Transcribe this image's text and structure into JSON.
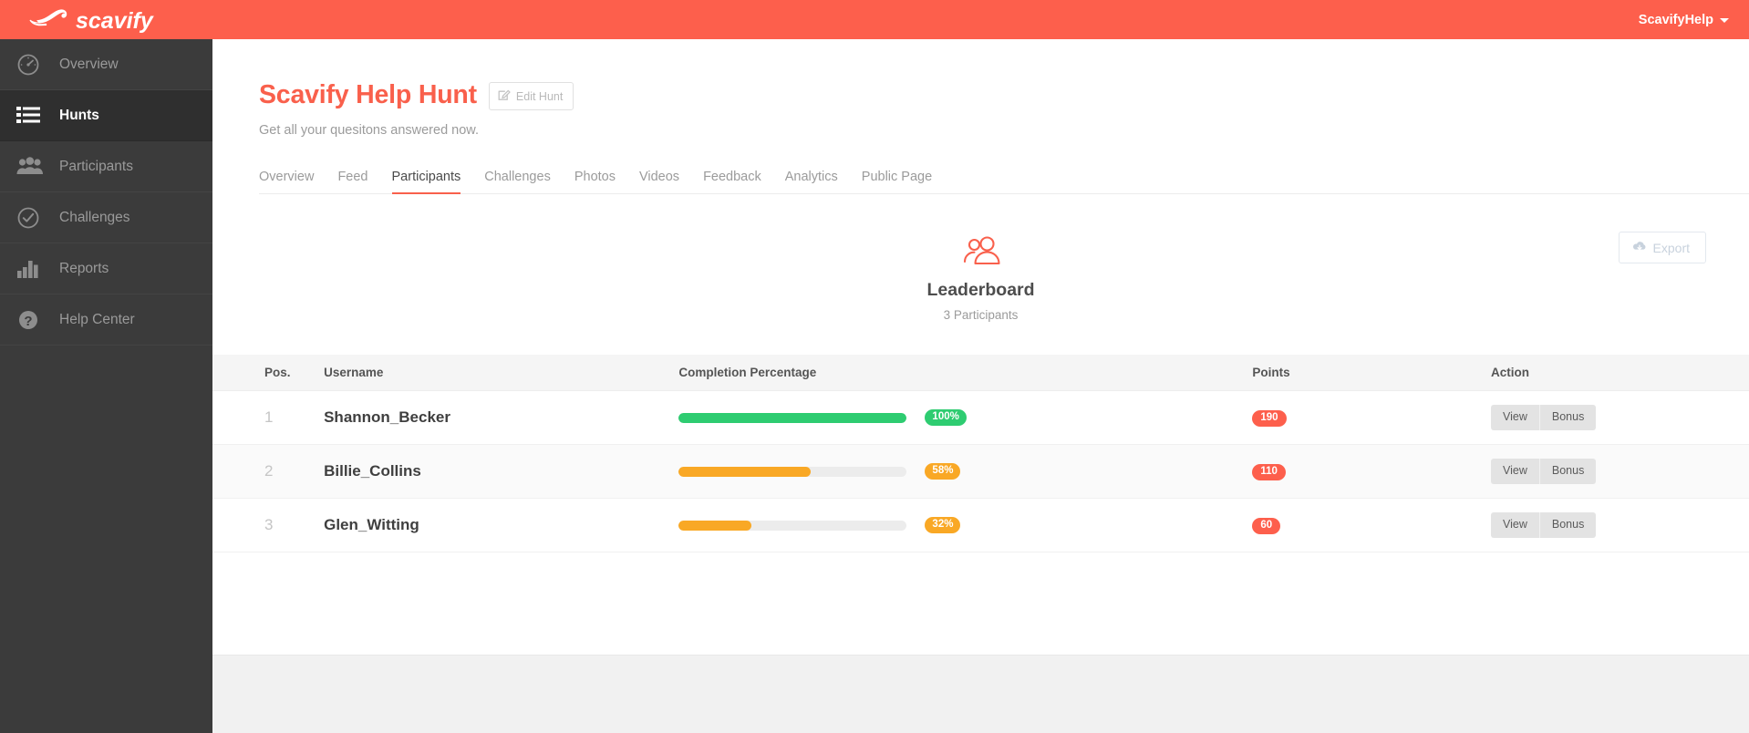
{
  "topbar": {
    "brand_name": "scavify",
    "brand_icon": "scavify-cheetah-logo",
    "user_menu_label": "ScavifyHelp",
    "caret_icon": "chevron-down-icon",
    "background_color": "#fd5f4c"
  },
  "sidebar": {
    "background_color": "#3b3b3b",
    "items": [
      {
        "label": "Overview",
        "icon": "gauge-icon",
        "active": false
      },
      {
        "label": "Hunts",
        "icon": "list-icon",
        "active": true
      },
      {
        "label": "Participants",
        "icon": "people-icon",
        "active": false
      },
      {
        "label": "Challenges",
        "icon": "check-circle-icon",
        "active": false
      },
      {
        "label": "Reports",
        "icon": "bar-chart-icon",
        "active": false
      },
      {
        "label": "Help Center",
        "icon": "question-mark-circle-icon",
        "active": false
      }
    ]
  },
  "page": {
    "title": "Scavify Help Hunt",
    "title_color": "#f9604c",
    "edit_button_label": "Edit Hunt",
    "edit_button_icon": "pencil-square-icon",
    "subtitle": "Get all your quesitons answered now."
  },
  "tabs": [
    {
      "label": "Overview",
      "active": false
    },
    {
      "label": "Feed",
      "active": false
    },
    {
      "label": "Participants",
      "active": true
    },
    {
      "label": "Challenges",
      "active": false
    },
    {
      "label": "Photos",
      "active": false
    },
    {
      "label": "Videos",
      "active": false
    },
    {
      "label": "Feedback",
      "active": false
    },
    {
      "label": "Analytics",
      "active": false
    },
    {
      "label": "Public Page",
      "active": false
    }
  ],
  "hero": {
    "icon": "people-group-icon",
    "icon_color": "#f9604c",
    "title": "Leaderboard",
    "subtitle": "3 Participants"
  },
  "export": {
    "label": "Export",
    "icon": "cloud-download-icon"
  },
  "table": {
    "columns": [
      "Pos.",
      "Username",
      "Completion Percentage",
      "Points",
      "Action"
    ],
    "action_buttons": [
      "View",
      "Bonus"
    ],
    "rows": [
      {
        "pos": "1",
        "username": "Shannon_Becker",
        "percent_label": "100%",
        "percent_value": 100,
        "bar_color": "#2ecc71",
        "pill_color": "#2ecc71",
        "points": "190"
      },
      {
        "pos": "2",
        "username": "Billie_Collins",
        "percent_label": "58%",
        "percent_value": 58,
        "bar_color": "#f9a game",
        "pill_color": "#f9a825",
        "points": "110"
      },
      {
        "pos": "3",
        "username": "Glen_Witting",
        "percent_label": "32%",
        "percent_value": 32,
        "bar_color": "#f9a825",
        "pill_color": "#f9a825",
        "points": "60"
      }
    ]
  }
}
